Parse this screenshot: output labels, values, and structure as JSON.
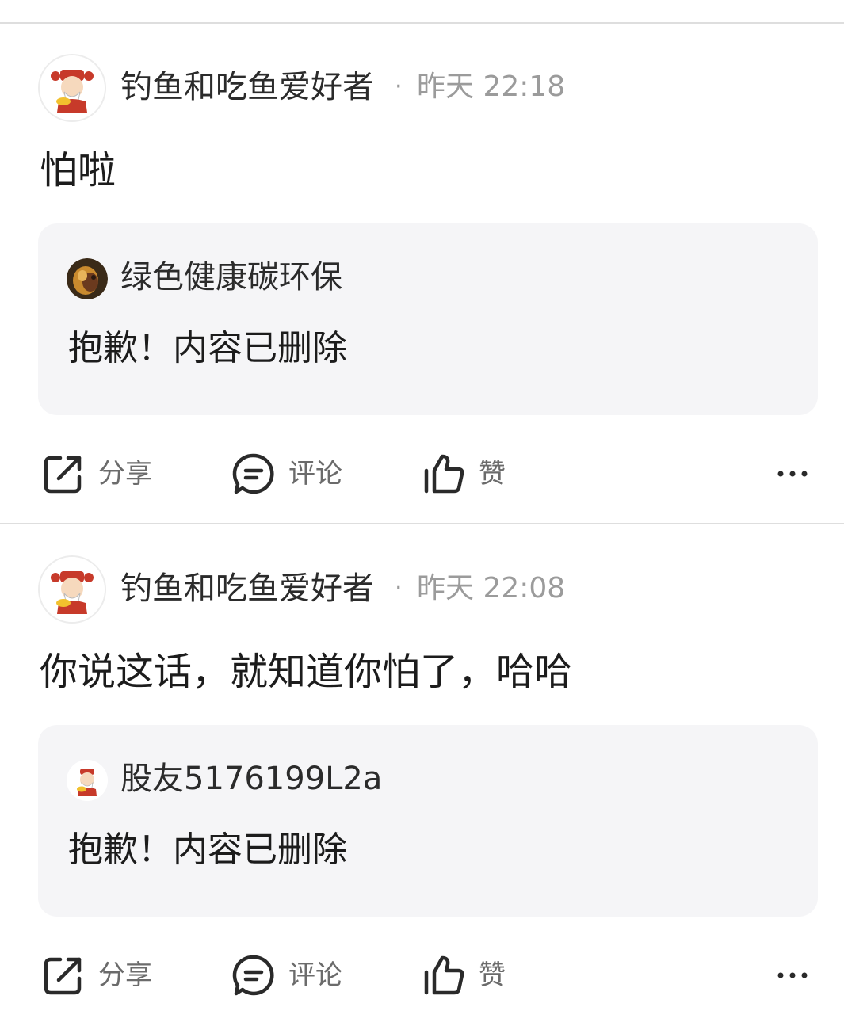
{
  "posts": [
    {
      "author": "钓鱼和吃鱼爱好者",
      "separator": "·",
      "time": "昨天 22:18",
      "content": "怕啦",
      "quote": {
        "author": "绿色健康碳环保",
        "text": "抱歉！内容已删除"
      },
      "actions": {
        "share": "分享",
        "comment": "评论",
        "like": "赞"
      }
    },
    {
      "author": "钓鱼和吃鱼爱好者",
      "separator": "·",
      "time": "昨天 22:08",
      "content": "你说这话，就知道你怕了，哈哈",
      "quote": {
        "author": "股友5176199L2a",
        "text": "抱歉！内容已删除"
      },
      "actions": {
        "share": "分享",
        "comment": "评论",
        "like": "赞"
      }
    }
  ],
  "icons": {
    "share": "share-icon",
    "comment": "comment-icon",
    "like": "thumbs-up-icon",
    "more": "more-icon"
  },
  "colors": {
    "text": "#1c1c1c",
    "meta": "#9b9b9b",
    "quote_bg": "#f5f5f7",
    "divider": "#dedede",
    "icon": "#2a2a2a"
  }
}
